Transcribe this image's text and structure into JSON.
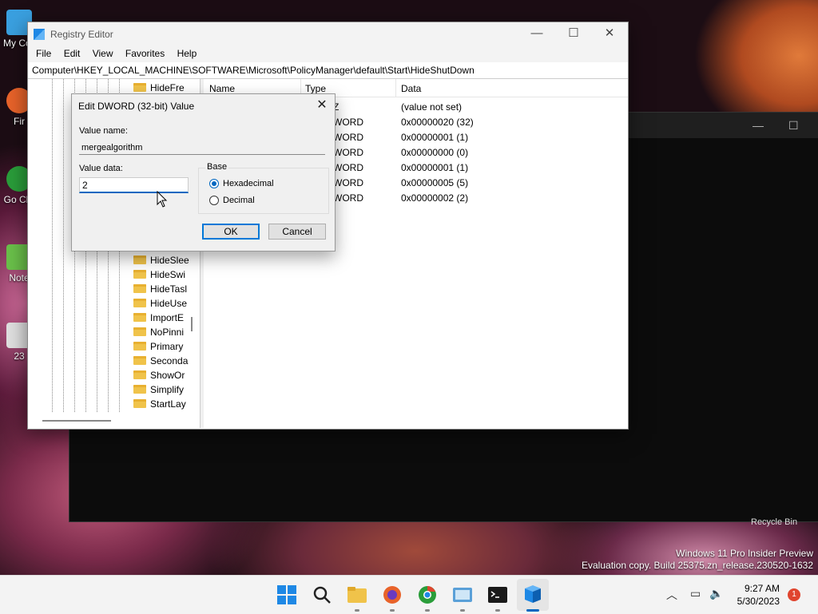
{
  "desktop": {
    "icons": [
      {
        "label": "My Co",
        "icon": "computer-icon",
        "color": "#3aa0e0"
      },
      {
        "label": "Fir",
        "icon": "firefox-icon",
        "color": "#e8632a"
      },
      {
        "label": "Go Chr",
        "icon": "chrome-icon",
        "color": "#2a9d3a"
      },
      {
        "label": "Note",
        "icon": "notepad-icon",
        "color": "#6ac04a"
      },
      {
        "label": "23",
        "icon": "file-icon",
        "color": "#e0e0e0"
      }
    ],
    "recycle_bin": "Recycle Bin",
    "watermark_line1": "Windows 11 Pro Insider Preview",
    "watermark_line2": "Evaluation copy. Build 25375.zn_release.230520-1632"
  },
  "registry": {
    "title": "Registry Editor",
    "menu": [
      "File",
      "Edit",
      "View",
      "Favorites",
      "Help"
    ],
    "address": "Computer\\HKEY_LOCAL_MACHINE\\SOFTWARE\\Microsoft\\PolicyManager\\default\\Start\\HideShutDown",
    "tree_items": [
      "HideFre",
      "HideSlee",
      "HideSwi",
      "HideTasl",
      "HideUse",
      "ImportE",
      "NoPinni",
      "Primary",
      "Seconda",
      "ShowOr",
      "Simplify",
      "StartLay"
    ],
    "columns": {
      "name": "Name",
      "type": "Type",
      "data": "Data"
    },
    "rows": [
      {
        "type": "Z",
        "data": "(value not set)"
      },
      {
        "type": "WORD",
        "data": "0x00000020 (32)"
      },
      {
        "type": "WORD",
        "data": "0x00000001 (1)"
      },
      {
        "type": "WORD",
        "data": "0x00000000 (0)"
      },
      {
        "type": "WORD",
        "data": "0x00000001 (1)"
      },
      {
        "type": "WORD",
        "data": "0x00000005 (5)"
      },
      {
        "type": "WORD",
        "data": "0x00000002 (2)"
      }
    ]
  },
  "dialog": {
    "title": "Edit DWORD (32-bit) Value",
    "value_name_label": "Value name:",
    "value_name": "mergealgorithm",
    "value_data_label": "Value data:",
    "value_data": "2",
    "base_label": "Base",
    "hex_label": "Hexadecimal",
    "dec_label": "Decimal",
    "ok": "OK",
    "cancel": "Cancel"
  },
  "taskbar": {
    "time": "9:27 AM",
    "date": "5/30/2023",
    "notifications": "1"
  }
}
